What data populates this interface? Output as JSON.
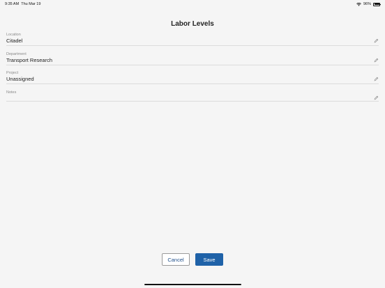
{
  "status_bar": {
    "time": "9:35 AM",
    "date": "Thu Mar 19",
    "battery_percent": "96%",
    "battery_level": 0.96
  },
  "page": {
    "title": "Labor Levels"
  },
  "fields": [
    {
      "label": "Location",
      "value": "Citadel"
    },
    {
      "label": "Department",
      "value": "Transport Research"
    },
    {
      "label": "Project",
      "value": "Unassigned"
    },
    {
      "label": "Notes",
      "value": ""
    }
  ],
  "actions": {
    "cancel_label": "Cancel",
    "save_label": "Save"
  },
  "colors": {
    "background": "#f5f5f5",
    "primary": "#1f62a8",
    "divider": "#dcdcdc"
  },
  "icons": {
    "edit": "pencil-icon",
    "wifi": "wifi-icon",
    "battery": "battery-icon"
  }
}
